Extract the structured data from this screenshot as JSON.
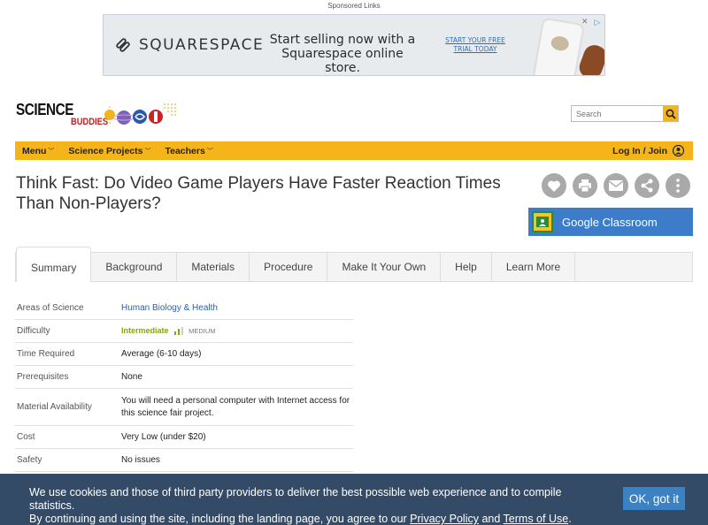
{
  "ad": {
    "sponsored_label": "Sponsored Links",
    "brand": "SQUARESPACE",
    "headline": "Start selling now with a Squarespace online store.",
    "cta": "START YOUR FREE TRIAL TODAY"
  },
  "header": {
    "logo_science": "SCIENCE",
    "logo_buddies": "BUDDIES",
    "search_placeholder": "Search"
  },
  "nav": {
    "items": [
      {
        "label": "Menu"
      },
      {
        "label": "Science Projects"
      },
      {
        "label": "Teachers"
      }
    ],
    "login": "Log In / Join"
  },
  "page": {
    "title": "Think Fast: Do Video Game Players Have Faster Reaction Times Than Non-Players?",
    "google_classroom": "Google Classroom"
  },
  "tabs": [
    "Summary",
    "Background",
    "Materials",
    "Procedure",
    "Make It Your Own",
    "Help",
    "Learn More"
  ],
  "info": {
    "areas_label": "Areas of Science",
    "areas_value": "Human Biology & Health",
    "difficulty_label": "Difficulty",
    "difficulty_value": "Intermediate",
    "difficulty_sub": "MEDIUM",
    "time_label": "Time Required",
    "time_value": "Average (6-10 days)",
    "prereq_label": "Prerequisites",
    "prereq_value": "None",
    "material_label": "Material Availability",
    "material_value": "You will need a personal computer with Internet access for this science fair project.",
    "cost_label": "Cost",
    "cost_value": "Very Low (under $20)",
    "safety_label": "Safety",
    "safety_value": "No issues"
  },
  "cookie": {
    "line1": "We use cookies and those of third party providers to deliver the best possible web experience and to compile statistics.",
    "line2_prefix": "By continuing and using the site, including the landing page, you agree to our ",
    "privacy_link": "Privacy Policy",
    "and": " and ",
    "terms_link": "Terms of Use",
    "period": ".",
    "ok_button": "OK, got it"
  },
  "colors": {
    "accent_yellow": "#f4b41a",
    "classroom_blue": "#3d7cc9",
    "cookie_bg": "#233c5a"
  }
}
